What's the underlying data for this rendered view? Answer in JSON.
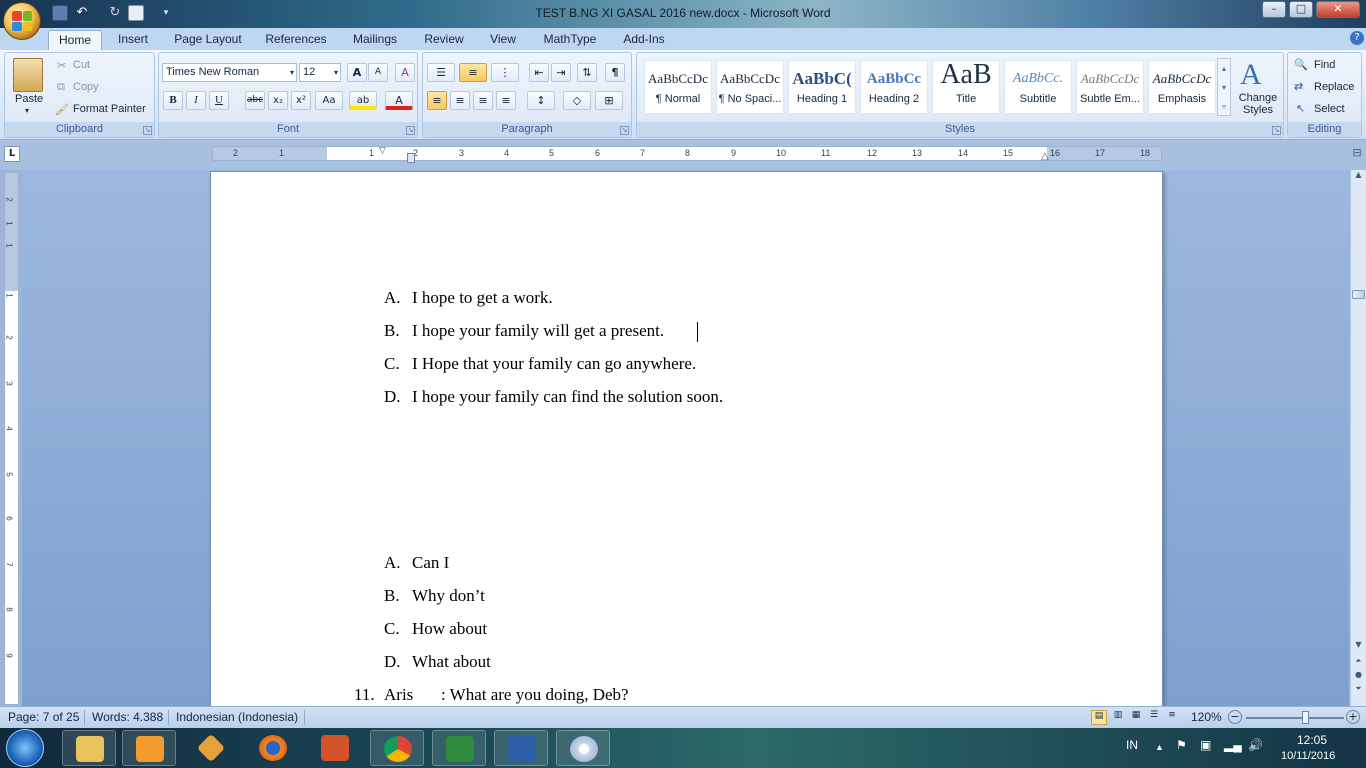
{
  "window": {
    "title": "TEST B.NG XI GASAL 2016 new.docx - Microsoft Word",
    "minimize": "–",
    "maximize": "□",
    "close": "✕"
  },
  "tabs": [
    "Home",
    "Insert",
    "Page Layout",
    "References",
    "Mailings",
    "Review",
    "View",
    "MathType",
    "Add-Ins"
  ],
  "active_tab": "Home",
  "clipboard": {
    "group_label": "Clipboard",
    "paste": "Paste",
    "cut": "Cut",
    "copy": "Copy",
    "format_painter": "Format Painter"
  },
  "font": {
    "group_label": "Font",
    "name": "Times New Roman",
    "size": "12",
    "grow": "A",
    "shrink": "A",
    "clear": "A",
    "bold": "B",
    "italic": "I",
    "underline": "U",
    "strike": "abc",
    "sub": "x₂",
    "sup": "x²",
    "case": "Aa",
    "highlight": "ab",
    "color": "A"
  },
  "paragraph": {
    "group_label": "Paragraph",
    "show_marks": "¶"
  },
  "styles": {
    "group_label": "Styles",
    "items": [
      {
        "preview": "AaBbCcDc",
        "name": "¶ Normal"
      },
      {
        "preview": "AaBbCcDc",
        "name": "¶ No Spaci..."
      },
      {
        "preview": "AaBbC(",
        "name": "Heading 1"
      },
      {
        "preview": "AaBbCc",
        "name": "Heading 2"
      },
      {
        "preview": "AaB",
        "name": "Title"
      },
      {
        "preview": "AaBbCc.",
        "name": "Subtitle"
      },
      {
        "preview": "AaBbCcDc",
        "name": "Subtle Em..."
      },
      {
        "preview": "AaBbCcDc",
        "name": "Emphasis"
      }
    ],
    "change_styles": "Change Styles"
  },
  "editing": {
    "group_label": "Editing",
    "find": "Find",
    "replace": "Replace",
    "select": "Select"
  },
  "ruler": {
    "h_labels": [
      "2",
      "1",
      "1",
      "2",
      "3",
      "4",
      "5",
      "6",
      "7",
      "8",
      "9",
      "10",
      "11",
      "12",
      "13",
      "14",
      "15",
      "16",
      "17",
      "18"
    ],
    "v_labels": [
      "2",
      "1",
      "1",
      "1",
      "2",
      "3",
      "4",
      "5",
      "6",
      "7",
      "8",
      "9"
    ]
  },
  "document": {
    "options_1": [
      {
        "letter": "A.",
        "text": "I hope to get a work."
      },
      {
        "letter": "B.",
        "text": "I hope your family will get a present."
      },
      {
        "letter": "C.",
        "text": "I Hope that your family can go anywhere."
      },
      {
        "letter": "D.",
        "text": "I hope your family can find the solution soon."
      }
    ],
    "options_2": [
      {
        "letter": "A.",
        "text": "Can I"
      },
      {
        "letter": "B.",
        "text": "Why don’t"
      },
      {
        "letter": "C.",
        "text": "How about"
      },
      {
        "letter": "D.",
        "text": "What about"
      }
    ],
    "question_11": {
      "number": "11.",
      "speaker": "Aris",
      "text": ": What are you doing, Deb?"
    }
  },
  "status": {
    "page": "Page: 7 of 25",
    "words": "Words: 4.388",
    "language": "Indonesian (Indonesia)",
    "zoom": "120%",
    "zoom_fraction": 0.6
  },
  "tray": {
    "lang": "IN",
    "time": "12:05",
    "date": "10/11/2016"
  }
}
